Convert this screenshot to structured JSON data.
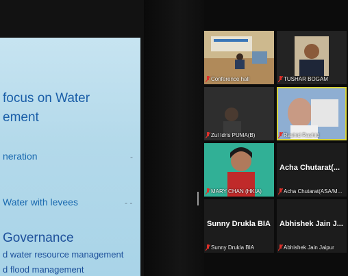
{
  "slide": {
    "title_line1": "focus on Water",
    "title_line2": "ement",
    "bullet1": "neration",
    "bullet2": "Water with levees",
    "heading": "Governance",
    "sub1": "d water resource management",
    "sub2": "d flood management"
  },
  "participants": [
    {
      "name": "Conference hall",
      "type": "video"
    },
    {
      "name": "TUSHAR BOGAM",
      "type": "video"
    },
    {
      "name": "Zul Idris PUMA(B)",
      "type": "video"
    },
    {
      "name": "Rashid Rashid",
      "type": "video",
      "active_speaker": true
    },
    {
      "name": "MARY CHAN (HKIA)",
      "type": "video"
    },
    {
      "name": "Acha Chutarat(ASA/M...",
      "display_name": "Acha Chutarat(...",
      "type": "name-only"
    },
    {
      "name": "Sunny Drukla BIA",
      "display_name": "Sunny Drukla BIA",
      "type": "name-only"
    },
    {
      "name": "Abhishek Jain Jaipur",
      "display_name": "Abhishek Jain J...",
      "type": "name-only"
    }
  ],
  "colors": {
    "active_speaker_border": "#d8d33a",
    "muted_mic": "#e0302a",
    "slide_text": "#1a5ea8"
  }
}
